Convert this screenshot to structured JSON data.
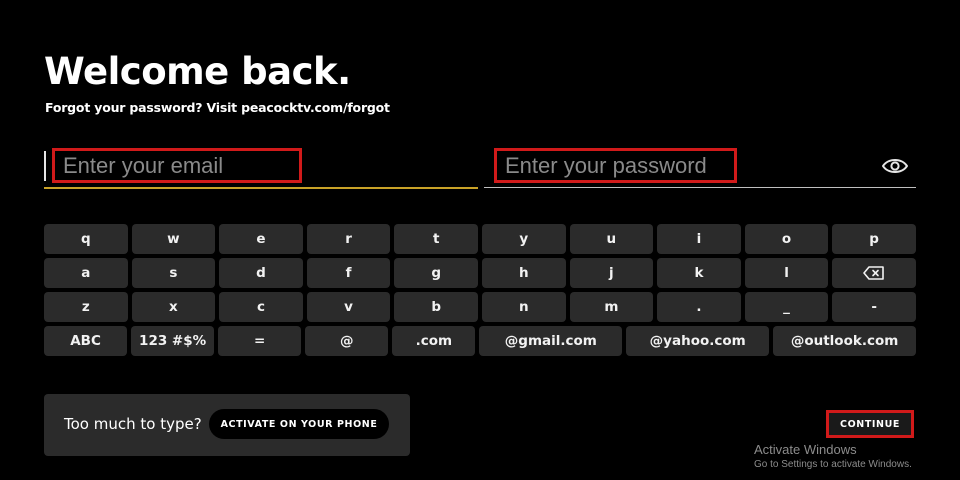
{
  "header": {
    "title": "Welcome back.",
    "subtitle": "Forgot your password? Visit peacocktv.com/forgot"
  },
  "email": {
    "placeholder": "Enter your email"
  },
  "password": {
    "placeholder": "Enter your password",
    "toggle_icon": "eye-icon"
  },
  "keyboard": {
    "row1": [
      "q",
      "w",
      "e",
      "r",
      "t",
      "y",
      "u",
      "i",
      "o",
      "p"
    ],
    "row2": [
      "a",
      "s",
      "d",
      "f",
      "g",
      "h",
      "j",
      "k",
      "l"
    ],
    "row2_backspace_icon": "backspace-icon",
    "row3": [
      "z",
      "x",
      "c",
      "v",
      "b",
      "n",
      "m",
      ".",
      "_",
      "-"
    ],
    "row4": [
      "ABC",
      "123 #$%",
      "=",
      "@",
      ".com",
      "@gmail.com",
      "@yahoo.com",
      "@outlook.com"
    ]
  },
  "assist": {
    "text": "Too much to type?",
    "button": "ACTIVATE ON YOUR PHONE"
  },
  "continue_label": "CONTINUE",
  "watermark": {
    "title": "Activate Windows",
    "subtitle": "Go to Settings to activate Windows."
  },
  "colors": {
    "background": "#000000",
    "key": "#2b2b2b",
    "highlight": "#d11a1a",
    "focus_underline": "#c9a227",
    "placeholder": "#8a8a8a"
  }
}
